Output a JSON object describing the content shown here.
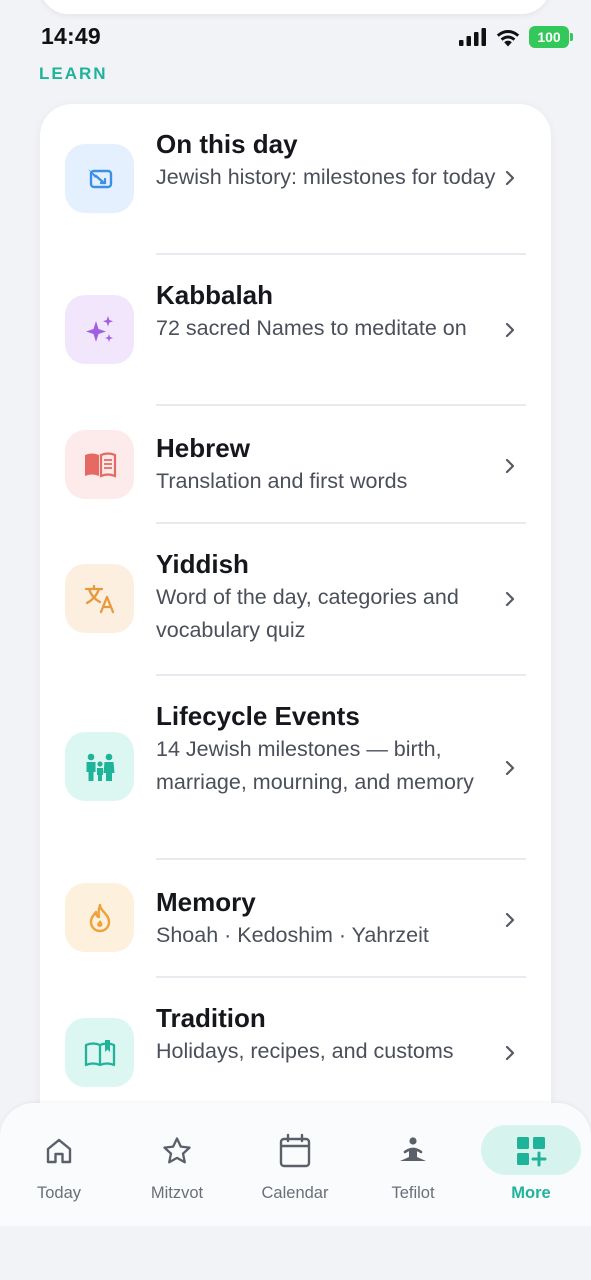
{
  "status_bar": {
    "time": "14:49",
    "battery": "100"
  },
  "section_label": "LEARN",
  "learn_items": [
    {
      "title": "On this day",
      "subtitle": "Jewish history: milestones for today",
      "icon": "history-icon",
      "tint": "#e4f0fd",
      "color": "#3b8fe8"
    },
    {
      "title": "Kabbalah",
      "subtitle": "72 sacred Names to meditate on",
      "icon": "sparkles-icon",
      "tint": "#f1e6fb",
      "color": "#a25ee0"
    },
    {
      "title": "Hebrew",
      "subtitle": "Translation and first words",
      "icon": "open-book-icon",
      "tint": "#fdeaea",
      "color": "#e56b62"
    },
    {
      "title": "Yiddish",
      "subtitle": "Word of the day, categories and vocabulary quiz",
      "icon": "translate-icon",
      "tint": "#fcefe0",
      "color": "#e59a3c"
    },
    {
      "title": "Lifecycle Events",
      "subtitle": "14 Jewish milestones — birth, marriage, mourning, and memory",
      "icon": "family-icon",
      "tint": "#dcf6f1",
      "color": "#1fb39a"
    },
    {
      "title": "Memory",
      "subtitle": "Shoah · Kedoshim · Yahrzeit",
      "icon": "flame-icon",
      "tint": "#fdf0dd",
      "color": "#f0a23a"
    },
    {
      "title": "Tradition",
      "subtitle": "Holidays, recipes, and customs",
      "icon": "book-flag-icon",
      "tint": "#dcf6f1",
      "color": "#1fb39a"
    }
  ],
  "tabs": [
    {
      "label": "Today",
      "icon": "home-icon"
    },
    {
      "label": "Mitzvot",
      "icon": "star-icon"
    },
    {
      "label": "Calendar",
      "icon": "calendar-icon"
    },
    {
      "label": "Tefilot",
      "icon": "prayer-icon"
    },
    {
      "label": "More",
      "icon": "grid-plus-icon",
      "active": true
    }
  ],
  "colors": {
    "accent": "#1fb39a",
    "background": "#f2f3f7",
    "card": "#ffffff"
  }
}
